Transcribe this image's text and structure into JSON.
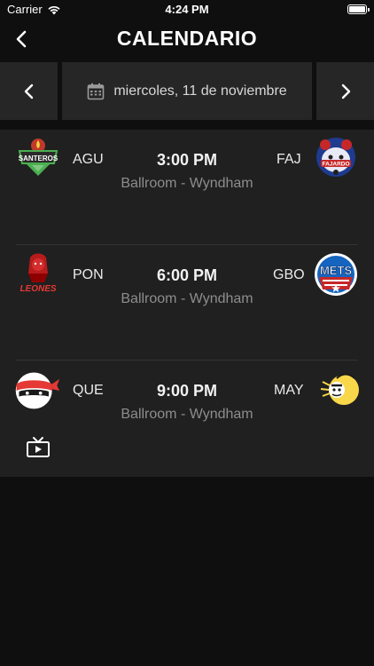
{
  "status_bar": {
    "carrier": "Carrier",
    "time": "4:24 PM"
  },
  "header": {
    "title": "CALENDARIO",
    "back_icon": "chevron-left-icon"
  },
  "date_nav": {
    "date_label": "miercoles, 11 de noviembre",
    "prev_icon": "chevron-left-icon",
    "next_icon": "chevron-right-icon",
    "calendar_icon": "calendar-icon"
  },
  "games": [
    {
      "home_abbr": "AGU",
      "home_logo": "santeros-logo",
      "home_logo_text": "SANTEROS",
      "away_abbr": "FAJ",
      "away_logo": "fajardo-logo",
      "away_logo_text": "FAJARDO",
      "time": "3:00 PM",
      "venue": "Ballroom - Wyndham"
    },
    {
      "home_abbr": "PON",
      "home_logo": "leones-logo",
      "home_logo_text": "LEONES",
      "away_abbr": "GBO",
      "away_logo": "mets-logo",
      "away_logo_text": "METS",
      "time": "6:00 PM",
      "venue": "Ballroom - Wyndham"
    },
    {
      "home_abbr": "QUE",
      "home_logo": "ninja-logo",
      "away_abbr": "MAY",
      "away_logo": "indio-logo",
      "time": "9:00 PM",
      "venue": "Ballroom - Wyndham",
      "broadcast_icon": "tv-icon"
    }
  ],
  "colors": {
    "background": "#0f0f0f",
    "panel": "#262626",
    "list": "#202020",
    "venue_text": "#8d8d8d"
  }
}
